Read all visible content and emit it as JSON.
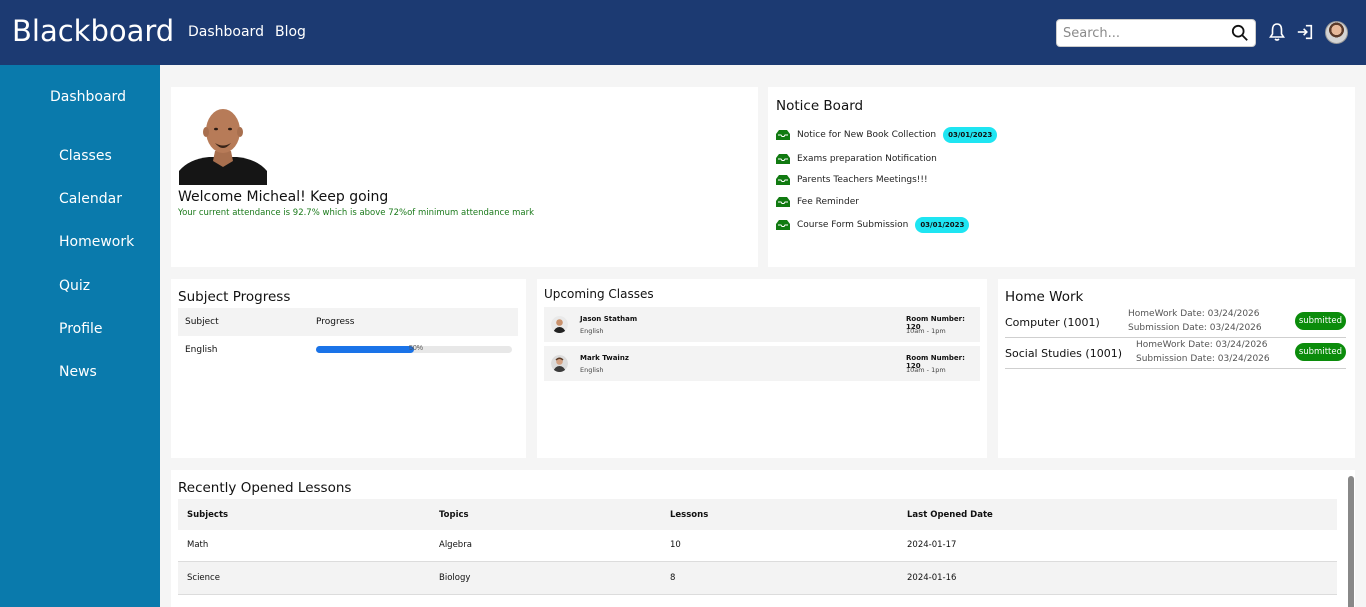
{
  "app": {
    "brand": "Blackboard"
  },
  "topnav": {
    "items": [
      "Dashboard",
      "Blog"
    ]
  },
  "search": {
    "placeholder": "Search..."
  },
  "sidebar": {
    "items": [
      "Dashboard",
      "Classes",
      "Calendar",
      "Homework",
      "Quiz",
      "Profile",
      "News"
    ]
  },
  "welcome": {
    "title": "Welcome Micheal! Keep going",
    "subtitle": "Your current attendance is 92.7% which is above 72%of minimum attendance mark"
  },
  "notice_board": {
    "title": "Notice Board",
    "items": [
      {
        "text": "Notice for New Book Collection",
        "date": "03/01/2023"
      },
      {
        "text": "Exams preparation Notification",
        "date": ""
      },
      {
        "text": "Parents Teachers Meetings!!!",
        "date": ""
      },
      {
        "text": "Fee Reminder",
        "date": ""
      },
      {
        "text": "Course Form Submission",
        "date": "03/01/2023"
      }
    ]
  },
  "subject_progress": {
    "title": "Subject Progress",
    "columns": [
      "Subject",
      "Progress"
    ],
    "rows": [
      {
        "subject": "English",
        "progress": 50,
        "progress_label": "50%"
      }
    ]
  },
  "upcoming_classes": {
    "title": "Upcoming Classes",
    "items": [
      {
        "teacher": "Jason Statham",
        "subject": "English",
        "room": "Room Number: 120",
        "time": "10am - 1pm"
      },
      {
        "teacher": "Mark Twainz",
        "subject": "English",
        "room": "Room Number: 120",
        "time": "10am - 1pm"
      }
    ]
  },
  "homework": {
    "title": "Home Work",
    "items": [
      {
        "name": "Computer (1001)",
        "homework_date": "HomeWork Date: 03/24/2026",
        "submission_date": "Submission Date: 03/24/2026",
        "status": "submitted"
      },
      {
        "name": "Social Studies (1001)",
        "homework_date": "HomeWork Date: 03/24/2026",
        "submission_date": "Submission Date: 03/24/2026",
        "status": "submitted"
      }
    ]
  },
  "recent_lessons": {
    "title": "Recently Opened Lessons",
    "columns": [
      "Subjects",
      "Topics",
      "Lessons",
      "Last Opened Date"
    ],
    "rows": [
      [
        "Math",
        "Algebra",
        "10",
        "2024-01-17"
      ],
      [
        "Science",
        "Biology",
        "8",
        "2024-01-16"
      ]
    ]
  },
  "colors": {
    "topbar": "#1c3a72",
    "sidebar": "#0a7aac",
    "badge_cyan": "#1ee5f2",
    "badge_green": "#0b8c0b",
    "progress": "#1a73e8"
  },
  "icons": [
    "search-icon",
    "bell-icon",
    "sign-in-icon",
    "inbox-icon"
  ]
}
